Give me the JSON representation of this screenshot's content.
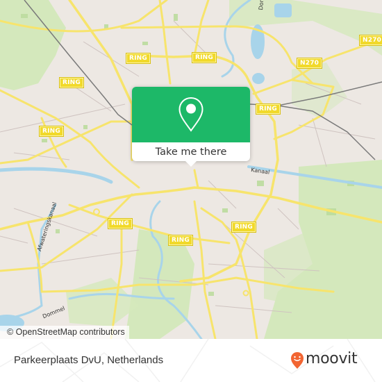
{
  "map": {
    "attribution": "© OpenStreetMap contributors",
    "road_shields": [
      {
        "label": "RING"
      },
      {
        "label": "RING"
      },
      {
        "label": "RING"
      },
      {
        "label": "RING"
      },
      {
        "label": "RING"
      },
      {
        "label": "RING"
      },
      {
        "label": "RING"
      },
      {
        "label": "RING"
      },
      {
        "label": "N270"
      },
      {
        "label": "N270"
      }
    ],
    "water_labels": {
      "afwatering": "Afwateringskanaal",
      "dommel": "Dommel",
      "dommel_north": "Dom",
      "kanaal": "Kanaal"
    },
    "colors": {
      "land": "#ede8e3",
      "park": "#cfe6b0",
      "water": "#a8d4ea",
      "road": "#f7e46c",
      "shield": "#f1d92a",
      "rail": "#777777"
    }
  },
  "popup": {
    "icon": "location-pin-icon",
    "action_label": "Take me there",
    "accent_color": "#1db868"
  },
  "footer": {
    "place_name": "Parkeerplaats DvU, Netherlands",
    "brand": "moovit",
    "brand_color": "#f26532"
  }
}
